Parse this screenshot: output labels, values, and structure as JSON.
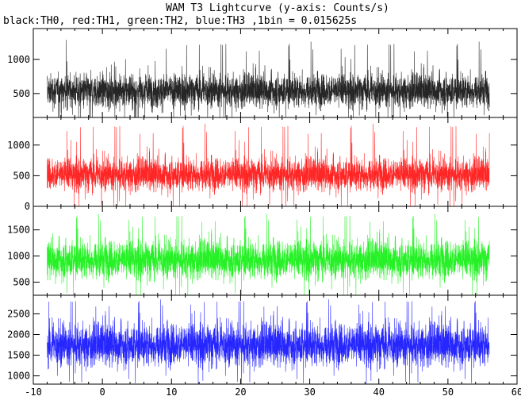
{
  "title": "WAM T3 Lightcurve (y-axis: Counts/s)",
  "subtitle": "black:TH0, red:TH1, green:TH2, blue:TH3 ,1bin = 0.015625s",
  "chart_data": {
    "type": "line",
    "title": "WAM T3 Lightcurve (y-axis: Counts/s)",
    "subtitle": "black:TH0, red:TH1, green:TH2, blue:TH3 ,1bin = 0.015625s",
    "x": {
      "start": -8.0,
      "end": 56.0,
      "bin_s": 0.015625
    },
    "xlim": [
      -10,
      60
    ],
    "x_ticks": [
      -10,
      0,
      10,
      20,
      30,
      40,
      50,
      60
    ],
    "panels": [
      {
        "name": "TH0",
        "color": "#000000",
        "ylim": [
          150,
          1450
        ],
        "y_ticks": [
          500,
          1000
        ],
        "mean": 540,
        "band_low": 300,
        "band_high": 800,
        "min": 150,
        "max": 1300
      },
      {
        "name": "TH1",
        "color": "#ff0000",
        "ylim": [
          0,
          1450
        ],
        "y_ticks": [
          0,
          500,
          1000
        ],
        "mean": 520,
        "band_low": 250,
        "band_high": 800,
        "min": 0,
        "max": 1400
      },
      {
        "name": "TH2",
        "color": "#00ee00",
        "ylim": [
          250,
          1950
        ],
        "y_ticks": [
          500,
          1000,
          1500
        ],
        "mean": 930,
        "band_low": 550,
        "band_high": 1300,
        "min": 250,
        "max": 1850
      },
      {
        "name": "TH3",
        "color": "#0000ff",
        "ylim": [
          800,
          2950
        ],
        "y_ticks": [
          1000,
          1500,
          2000,
          2500
        ],
        "mean": 1750,
        "band_low": 1250,
        "band_high": 2300,
        "min": 800,
        "max": 2900
      }
    ]
  }
}
